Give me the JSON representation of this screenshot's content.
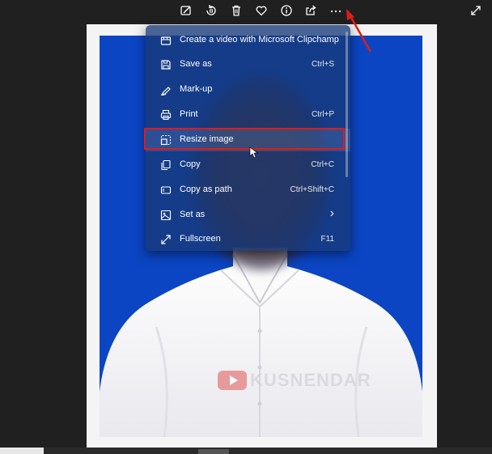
{
  "toolbar": {
    "buttons": [
      {
        "icon": "edit-image-icon"
      },
      {
        "icon": "rotate-icon"
      },
      {
        "icon": "delete-icon"
      },
      {
        "icon": "favorite-heart-icon"
      },
      {
        "icon": "info-icon"
      },
      {
        "icon": "share-icon"
      },
      {
        "icon": "more-options-icon"
      }
    ],
    "expand_icon": "expand-icon"
  },
  "context_menu": {
    "items": [
      {
        "label": "Create a video with Microsoft Clipchamp",
        "shortcut": "",
        "icon": "clipchamp-icon"
      },
      {
        "label": "Save as",
        "shortcut": "Ctrl+S",
        "icon": "save-icon"
      },
      {
        "label": "Mark-up",
        "shortcut": "",
        "icon": "markup-pen-icon"
      },
      {
        "label": "Print",
        "shortcut": "Ctrl+P",
        "icon": "printer-icon"
      },
      {
        "label": "Resize image",
        "shortcut": "",
        "icon": "resize-icon"
      },
      {
        "label": "Copy",
        "shortcut": "Ctrl+C",
        "icon": "copy-icon"
      },
      {
        "label": "Copy as path",
        "shortcut": "Ctrl+Shift+C",
        "icon": "copy-path-icon"
      },
      {
        "label": "Set as",
        "shortcut": "›",
        "icon": "set-as-icon"
      },
      {
        "label": "Fullscreen",
        "shortcut": "F11",
        "icon": "fullscreen-icon"
      }
    ],
    "highlighted": "Resize image"
  },
  "watermark": {
    "text": "KUSNENDAR"
  },
  "colors": {
    "background": "#202020",
    "photo_background": "#0b45c3",
    "menu": "#183a78",
    "highlight_border": "#e01b1b"
  }
}
